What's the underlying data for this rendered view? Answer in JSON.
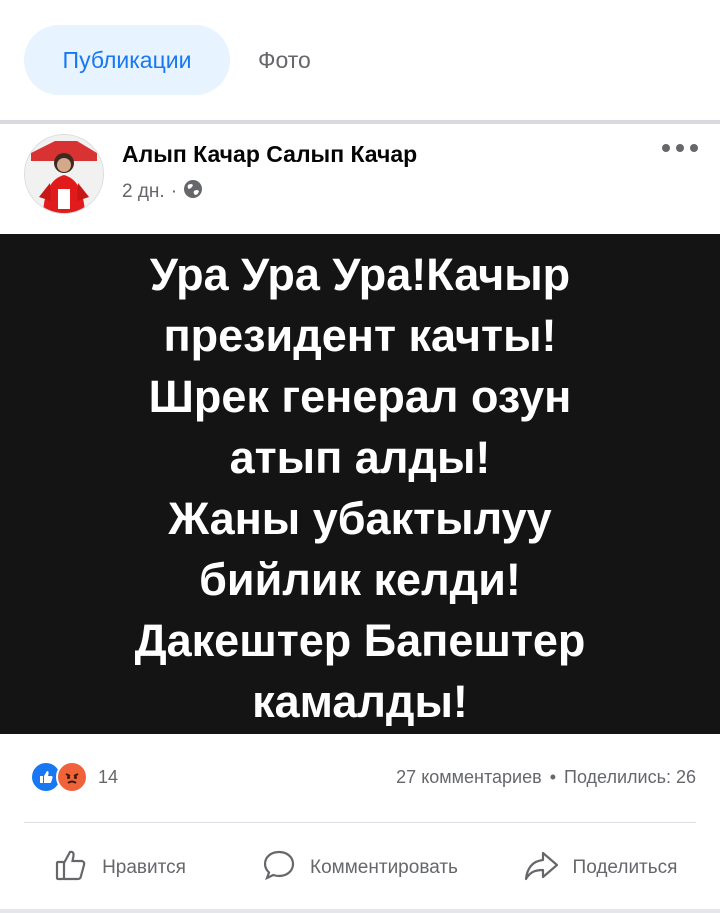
{
  "tabs": {
    "active": "Публикации",
    "photo": "Фото"
  },
  "post": {
    "author": "Алып Качар Салып Качар",
    "time": "2 дн.",
    "separator": "·",
    "image_text": "Ура Ура Ура!Качыр\nпрезидент качты!\nШрек генерал озун\nатып алды!\nЖаны убактылуу\nбийлик келди!\nДакештер Бапештер\nкамалды!"
  },
  "stats": {
    "reactions_count": "14",
    "comments": "27 комментариев",
    "dot": "•",
    "shares": "Поделились: 26"
  },
  "actions": {
    "like": "Нравится",
    "comment": "Комментировать",
    "share": "Поделиться"
  },
  "colors": {
    "accent": "#1877f2",
    "muted": "#65676b",
    "image_bg": "#141414",
    "angry": "#f0633a"
  }
}
